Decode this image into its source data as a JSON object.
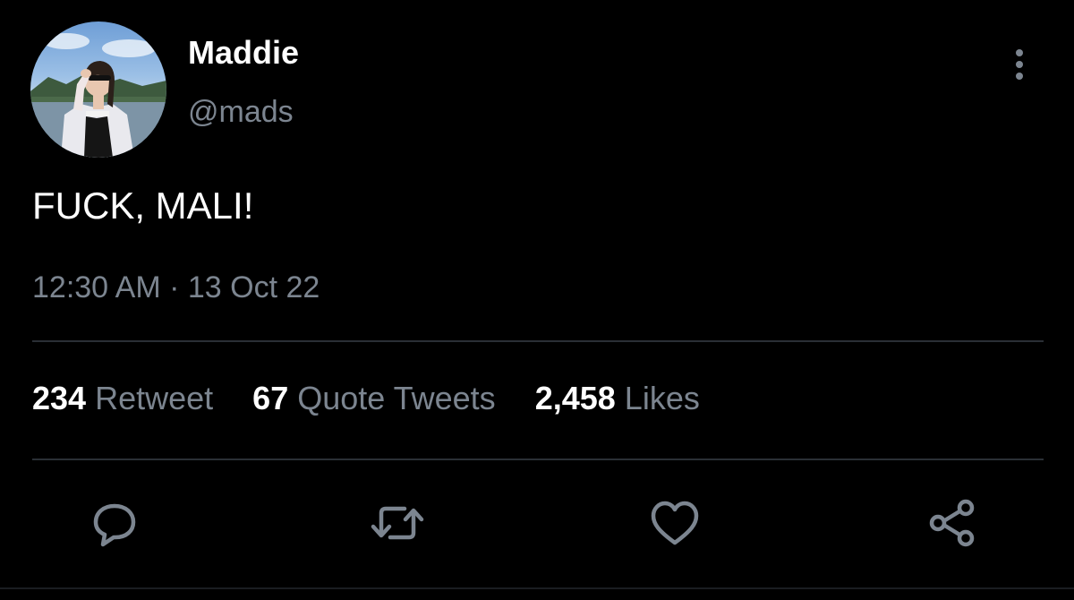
{
  "tweet": {
    "author": {
      "display_name": "Maddie",
      "handle": "@mads",
      "avatar_icon": "profile-photo"
    },
    "more_icon": "vertical-ellipsis-icon",
    "text": "FUCK, MALI!",
    "time": "12:30 AM",
    "separator": "·",
    "date": "13 Oct 22",
    "stats": {
      "retweets": {
        "count": "234",
        "label": "Retweet"
      },
      "quotes": {
        "count": "67",
        "label": "Quote Tweets"
      },
      "likes": {
        "count": "2,458",
        "label": "Likes"
      }
    },
    "actions": [
      {
        "name": "reply",
        "icon": "speech-bubble-icon"
      },
      {
        "name": "retweet",
        "icon": "retweet-arrows-icon"
      },
      {
        "name": "like",
        "icon": "heart-icon"
      },
      {
        "name": "share",
        "icon": "share-nodes-icon"
      }
    ]
  },
  "colors": {
    "background": "#000000",
    "primary_text": "#ffffff",
    "secondary_text": "#7c8590",
    "icon": "#7c8590",
    "divider": "#2a2f35"
  }
}
